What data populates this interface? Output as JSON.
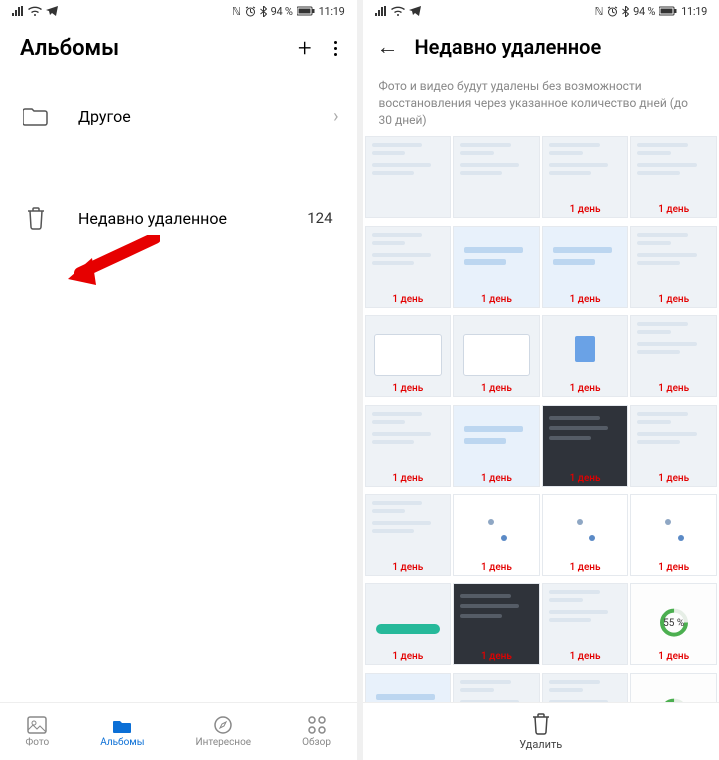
{
  "status": {
    "left_icons": [
      "signal",
      "wifi",
      "telegram"
    ],
    "nfc": "ℕ",
    "alarm": "⏰",
    "bluetooth": "✱",
    "battery_pct": "94 %",
    "time": "11:19"
  },
  "albums": {
    "title": "Альбомы",
    "items": [
      {
        "icon": "folder",
        "label": "Другое",
        "chevron": true
      },
      {
        "icon": "trash",
        "label": "Недавно удаленное",
        "count": "124"
      }
    ]
  },
  "nav": {
    "items": [
      {
        "key": "photos",
        "label": "Фото"
      },
      {
        "key": "albums",
        "label": "Альбомы",
        "active": true
      },
      {
        "key": "discover",
        "label": "Интересное"
      },
      {
        "key": "browse",
        "label": "Обзор"
      }
    ]
  },
  "deleted": {
    "title": "Недавно удаленное",
    "notice": "Фото и видео будут удалены без возможности восстановления через указанное количество дней (до 30 дней)",
    "days_label": "1 день",
    "percent": "55 %",
    "action_label": "Удалить",
    "thumbs": [
      {
        "v": "v1"
      },
      {
        "v": "v1"
      },
      {
        "v": "v1"
      },
      {
        "v": "v1"
      },
      {
        "v": "v1"
      },
      {
        "v": "v2"
      },
      {
        "v": "v2"
      },
      {
        "v": "v1"
      },
      {
        "v": "v6"
      },
      {
        "v": "v6"
      },
      {
        "v": "v7"
      },
      {
        "v": "v1"
      },
      {
        "v": "v1"
      },
      {
        "v": "v2"
      },
      {
        "v": "v5"
      },
      {
        "v": "v1"
      },
      {
        "v": "v1"
      },
      {
        "v": "v3"
      },
      {
        "v": "v3"
      },
      {
        "v": "v3"
      },
      {
        "v": "v8"
      },
      {
        "v": "v5"
      },
      {
        "v": "v1"
      },
      {
        "v": "v4"
      },
      {
        "v": "v2"
      },
      {
        "v": "v1"
      },
      {
        "v": "v1"
      },
      {
        "v": "v4"
      }
    ]
  }
}
